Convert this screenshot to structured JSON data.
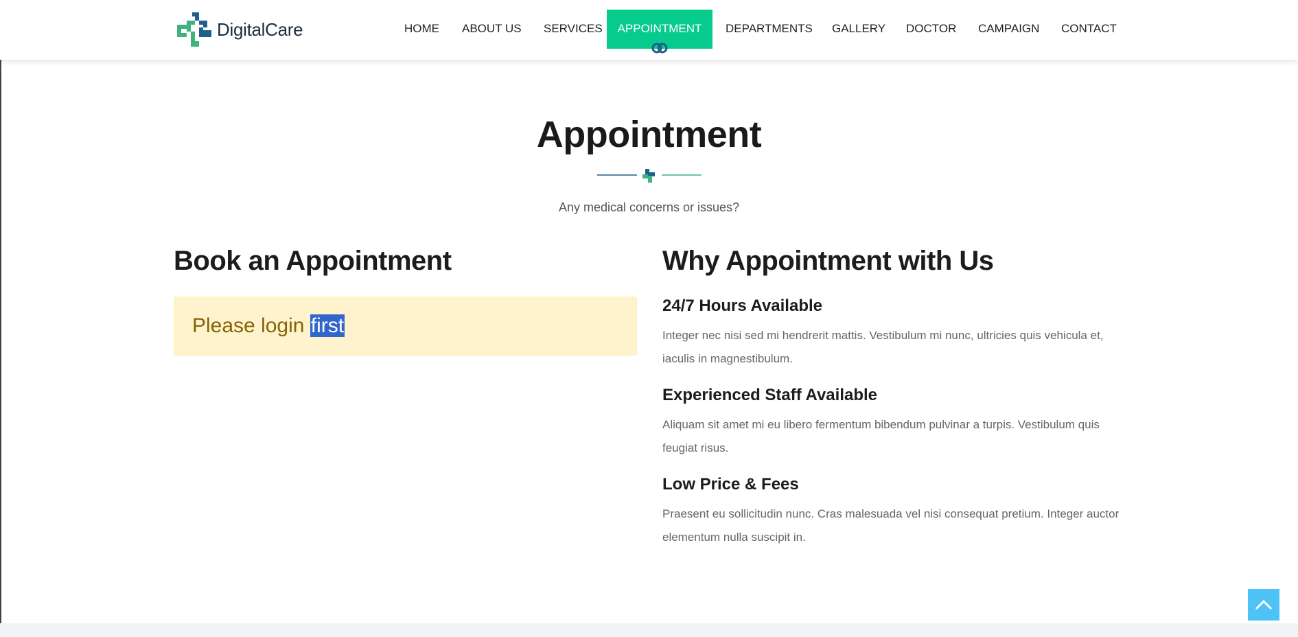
{
  "brand": {
    "name": "DigitalCare",
    "colors": {
      "primary": "#07cb8c",
      "secondary": "#1e5f8c"
    }
  },
  "nav": {
    "items": [
      {
        "label": "HOME"
      },
      {
        "label": "ABOUT US"
      },
      {
        "label": "SERVICES"
      },
      {
        "label": "APPOINTMENT",
        "active": true
      },
      {
        "label": "DEPARTMENTS"
      },
      {
        "label": "GALLERY"
      },
      {
        "label": "DOCTOR"
      },
      {
        "label": "CAMPAIGN"
      },
      {
        "label": "CONTACT"
      }
    ]
  },
  "section": {
    "title": "Appointment",
    "subtitle": "Any medical concerns or issues?"
  },
  "booking": {
    "heading": "Book an Appointment",
    "alert": {
      "text_prefix": "Please login ",
      "text_highlight": "first",
      "bg_color": "#fff3cd"
    }
  },
  "why": {
    "heading": "Why Appointment with Us",
    "features": [
      {
        "title": "24/7 Hours Available",
        "description": "Integer nec nisi sed mi hendrerit mattis. Vestibulum mi nunc, ultricies quis vehicula et, iaculis in magnestibulum."
      },
      {
        "title": "Experienced Staff Available",
        "description": "Aliquam sit amet mi eu libero fermentum bibendum pulvinar a turpis. Vestibulum quis feugiat risus."
      },
      {
        "title": "Low Price & Fees",
        "description": "Praesent eu sollicitudin nunc. Cras malesuada vel nisi consequat pretium. Integer auctor elementum nulla suscipit in."
      }
    ]
  },
  "icons": {
    "back_to_top": "chevron-up-icon",
    "logo": "medical-cross-icon"
  }
}
